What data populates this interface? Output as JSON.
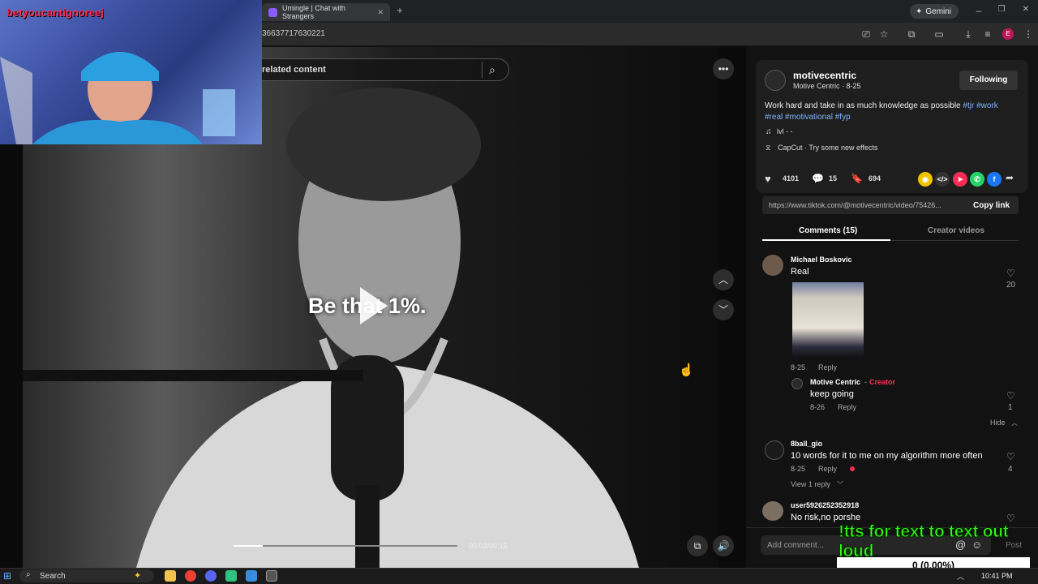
{
  "browser": {
    "tab_title": "Umingle | Chat with Strangers",
    "new_tab": "+",
    "gemini_label": "Gemini",
    "profile_initial": "E",
    "url": "36637717630221"
  },
  "webcam": {
    "overlay_name": "betyoucantignoreej"
  },
  "video": {
    "search_placeholder": "related content",
    "caption": "Be that 1%.",
    "progress_fraction": 0.13,
    "time": "00:02/00:15"
  },
  "post": {
    "username": "motivecentric",
    "display_meta": "Motive Centric · 8-25",
    "follow_button": "Following",
    "description": "Work hard and take in as much knowledge as possible",
    "hashtags": [
      "#tjr",
      "#work",
      "#real",
      "#motivational",
      "#fyp"
    ],
    "sound": "lvl - -",
    "effect": "CapCut · Try some new effects",
    "likes": "4101",
    "comments_count": "15",
    "saves": "694",
    "link": "https://www.tiktok.com/@motivecentric/video/75426...",
    "copy_link": "Copy link"
  },
  "tabs": {
    "comments": "Comments (15)",
    "creator_videos": "Creator videos"
  },
  "comments": [
    {
      "user": "Michael Boskovic",
      "text": "Real",
      "date": "8-25",
      "reply": "Reply",
      "likes": "20"
    },
    {
      "user": "Motive Centric",
      "creator_badge": "Creator",
      "text": "keep going",
      "date": "8-26",
      "reply": "Reply",
      "likes": "1",
      "hide": "Hide"
    },
    {
      "user": "8ball_gio",
      "text": "10 words for it to me on my algorithm more often",
      "date": "8-25",
      "reply": "Reply",
      "likes": "4",
      "view_replies": "View 1 reply"
    },
    {
      "user": "user5926252352918",
      "text": "No risk,no porshe"
    }
  ],
  "composer": {
    "placeholder": "Add comment...",
    "post_label": "Post"
  },
  "stream_overlay": {
    "tts_text": "!tts for text to text out loud",
    "counter": "0 (0.00%)"
  },
  "taskbar": {
    "search_label": "Search",
    "clock": "10:41 PM"
  }
}
